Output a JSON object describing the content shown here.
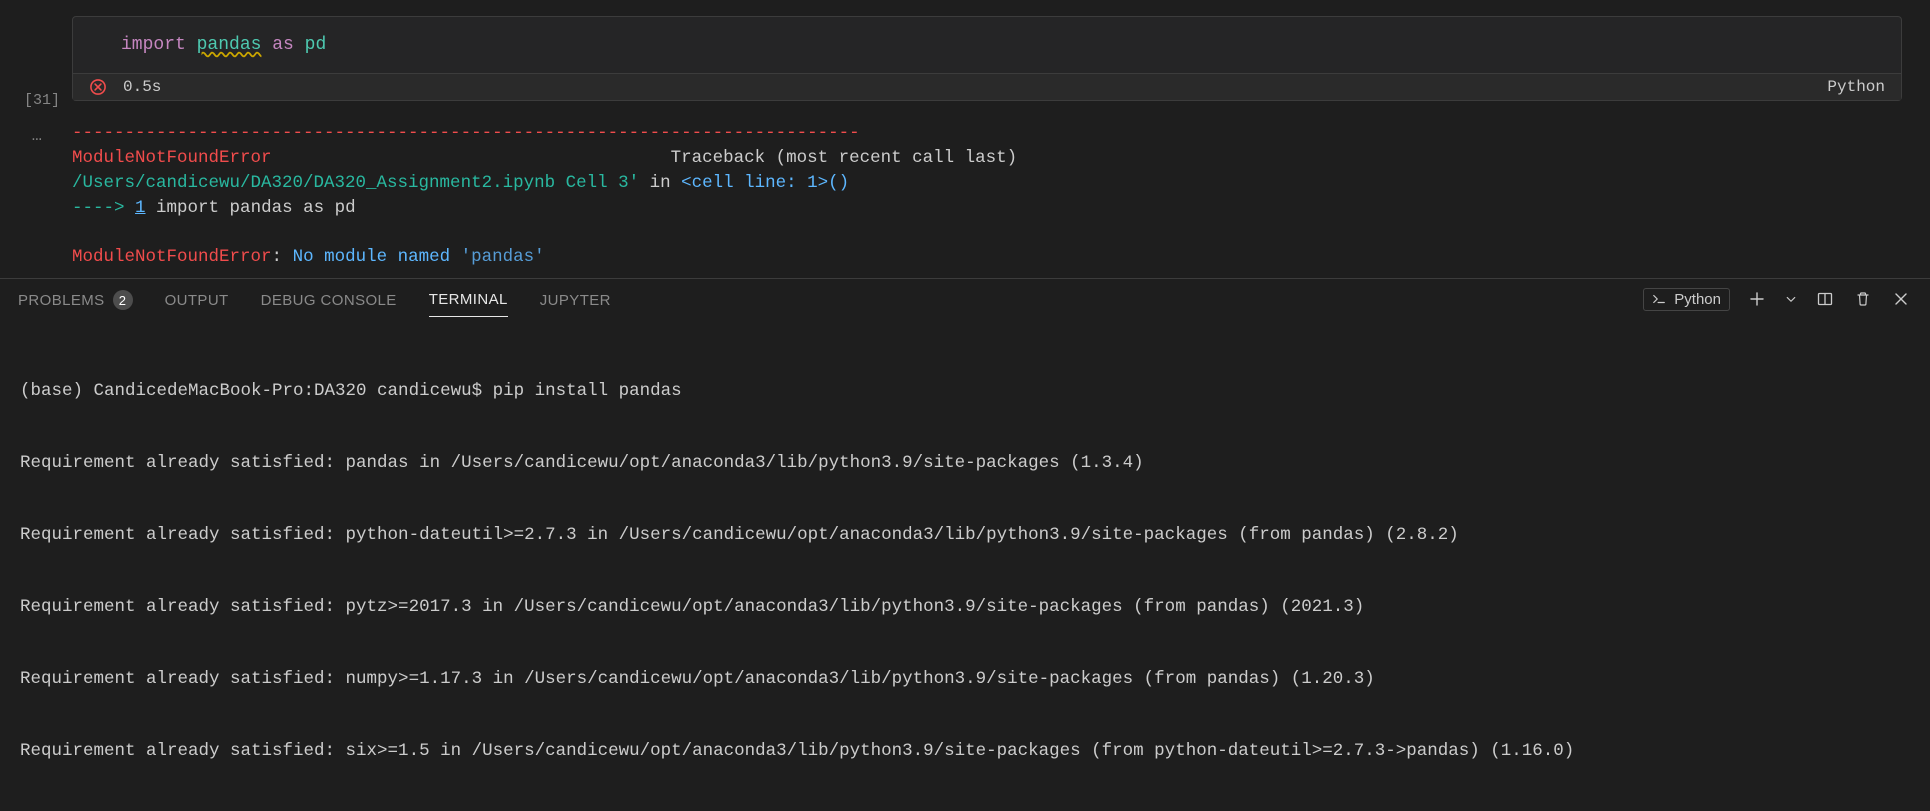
{
  "cell": {
    "execution_label": "[31]",
    "code": {
      "kw_import": "import",
      "module": "pandas",
      "kw_as": "as",
      "alias": "pd"
    },
    "duration": "0.5s",
    "kernel_lang": "Python"
  },
  "output": {
    "separator": "---------------------------------------------------------------------------",
    "error_name": "ModuleNotFoundError",
    "traceback_label": "Traceback (most recent call last)",
    "file_path": "/Users/candicewu/DA320/DA320_Assignment2.ipynb Cell 3'",
    "in_word": " in ",
    "cell_line": "<cell line: 1>",
    "paren": "()",
    "arrow": "---->",
    "line_num": "1",
    "code_line": " import pandas as pd",
    "error_name2": "ModuleNotFoundError",
    "colon": ": ",
    "error_msg_prefix": "No module named ",
    "error_msg_str": "'pandas'"
  },
  "panel": {
    "tabs": {
      "problems": "PROBLEMS",
      "problems_count": "2",
      "output": "OUTPUT",
      "debug": "DEBUG CONSOLE",
      "terminal": "TERMINAL",
      "jupyter": "JUPYTER"
    },
    "kernel_name": "Python"
  },
  "terminal": {
    "line1": "(base) CandicedeMacBook-Pro:DA320 candicewu$ pip install pandas",
    "line2": "Requirement already satisfied: pandas in /Users/candicewu/opt/anaconda3/lib/python3.9/site-packages (1.3.4)",
    "line3": "Requirement already satisfied: python-dateutil>=2.7.3 in /Users/candicewu/opt/anaconda3/lib/python3.9/site-packages (from pandas) (2.8.2)",
    "line4": "Requirement already satisfied: pytz>=2017.3 in /Users/candicewu/opt/anaconda3/lib/python3.9/site-packages (from pandas) (2021.3)",
    "line5": "Requirement already satisfied: numpy>=1.17.3 in /Users/candicewu/opt/anaconda3/lib/python3.9/site-packages (from pandas) (1.20.3)",
    "line6": "Requirement already satisfied: six>=1.5 in /Users/candicewu/opt/anaconda3/lib/python3.9/site-packages (from python-dateutil>=2.7.3->pandas) (1.16.0)"
  },
  "output_ellipsis": "…"
}
